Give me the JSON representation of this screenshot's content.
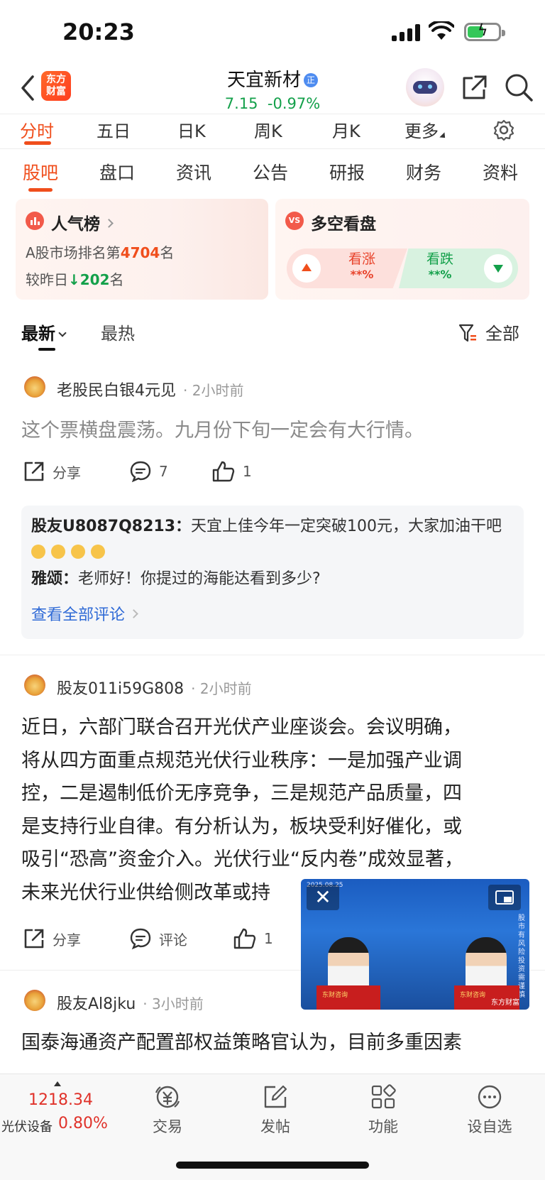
{
  "status_bar": {
    "time": "20:23"
  },
  "header": {
    "logo_line1": "东方",
    "logo_line2": "财富",
    "stock_name": "天宜新材",
    "verify_badge": "正",
    "price": "7.15",
    "change": "-0.97%"
  },
  "chart_tabs": [
    "分时",
    "五日",
    "日K",
    "周K",
    "月K",
    "更多"
  ],
  "section_tabs": [
    "股吧",
    "盘口",
    "资讯",
    "公告",
    "研报",
    "财务",
    "资料"
  ],
  "popularity": {
    "title": "人气榜",
    "rank_prefix": "A股市场排名第",
    "rank": "4704",
    "rank_suffix": "名",
    "change_prefix": "较昨日",
    "change_value": "202",
    "change_suffix": "名"
  },
  "long_short": {
    "badge": "VS",
    "title": "多空看盘",
    "up_label": "看涨",
    "up_pct": "**%",
    "down_label": "看跌",
    "down_pct": "**%"
  },
  "sort": {
    "latest": "最新",
    "hot": "最热",
    "filter": "全部"
  },
  "posts": [
    {
      "author": "老股民白银4元见",
      "time": "· 2小时前",
      "content": "这个票横盘震荡。九月份下旬一定会有大行情。",
      "share": "分享",
      "comments": "7",
      "likes": "1",
      "comment_list": [
        {
          "user": "股友U8087Q8213：",
          "text": "天宜上佳今年一定突破100元，大家加油干吧"
        },
        {
          "user": "雅颂：",
          "text": "老师好！你提过的海能达看到多少?"
        }
      ],
      "view_all": "查看全部评论"
    },
    {
      "author": "股友011i59G808",
      "time": "· 2小时前",
      "content_lines": [
        "近日，六部门联合召开光伏产业座谈会。会议明确，",
        "将从四方面重点规范光伏行业秩序：一是加强产业调",
        "控，二是遏制低价无序竞争，三是规范产品质量，四",
        "是支持行业自律。有分析认为，板块受利好催化，或",
        "吸引“恐高”资金介入。光伏行业“反内卷”成效显著，",
        "未来光伏行业供给侧改革或持"
      ],
      "share": "分享",
      "comment": "评论",
      "likes": "1"
    },
    {
      "author": "股友Al8jku",
      "time": "· 3小时前",
      "content_lines": [
        "国泰海通资产配置部权益策略官认为，目前多重因素"
      ]
    }
  ],
  "video": {
    "date": "2025.08.25",
    "watermark": "股市有风险投资需谨慎",
    "desk_left": "东财咨询",
    "desk_right": "东财咨询",
    "brand": "东方财富"
  },
  "bottom_nav": {
    "index_value": "1218.34",
    "index_name": "光伏设备",
    "index_pct": "0.80%",
    "items": [
      "交易",
      "发帖",
      "功能",
      "设自选"
    ]
  },
  "colors": {
    "accent": "#f04e1c",
    "up": "#e0322a",
    "down": "#13a04a",
    "link": "#2f6ad6"
  }
}
